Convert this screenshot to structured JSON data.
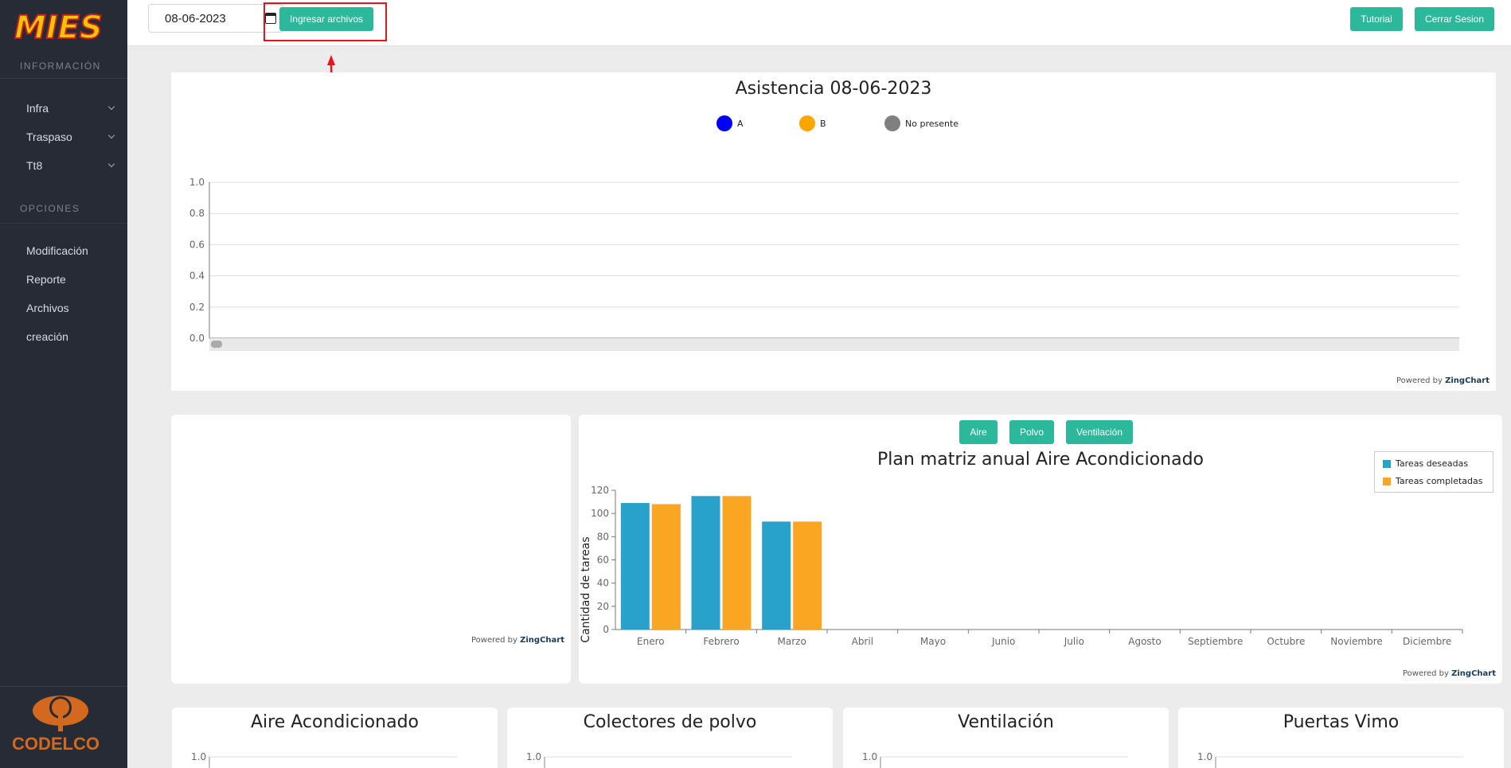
{
  "sidebar": {
    "logo_text": "MIES",
    "section_info": "INFORMACIÓN",
    "info_items": [
      {
        "label": "Infra"
      },
      {
        "label": "Traspaso"
      },
      {
        "label": "Tt8"
      }
    ],
    "section_options": "OPCIONES",
    "option_items": [
      {
        "label": "Modificación"
      },
      {
        "label": "Reporte"
      },
      {
        "label": "Archivos"
      },
      {
        "label": "creación"
      }
    ],
    "footer_logo_text": "CODELCO"
  },
  "topbar": {
    "date_value": "08-06-2023",
    "upload_button": "Ingresar archivos",
    "tutorial_button": "Tutorial",
    "logout_button": "Cerrar Sesion"
  },
  "colors": {
    "accent": "#2cb89a",
    "annotation": "#e4151c",
    "series_blue": "#29a2cb",
    "series_orange": "#fba623"
  },
  "attendance_chart": {
    "title": "Asistencia 08-06-2023",
    "legend": [
      {
        "label": "A",
        "color": "#0000ff"
      },
      {
        "label": "B",
        "color": "#ffa500"
      },
      {
        "label": "No presente",
        "color": "#808080"
      }
    ],
    "y_ticks": [
      "1.0",
      "0.8",
      "0.6",
      "0.4",
      "0.2",
      "0.0"
    ],
    "powered_prefix": "Powered by",
    "powered_brand": "ZingChart"
  },
  "empty_chart": {
    "powered_prefix": "Powered by",
    "powered_brand": "ZingChart"
  },
  "plan_chart": {
    "filter_buttons": [
      {
        "label": "Aire"
      },
      {
        "label": "Polvo"
      },
      {
        "label": "Ventilación"
      }
    ],
    "powered_prefix": "Powered by",
    "powered_brand": "ZingChart"
  },
  "chart_data": [
    {
      "type": "bar",
      "title": "Asistencia 08-06-2023",
      "series": [
        {
          "name": "A",
          "values": []
        },
        {
          "name": "B",
          "values": []
        },
        {
          "name": "No presente",
          "values": []
        }
      ],
      "ylim": [
        0,
        1.0
      ],
      "grid": true,
      "legend_position": "top-center"
    },
    {
      "type": "bar",
      "title": "Plan matriz anual Aire Acondicionado",
      "ylabel": "Cantidad de tareas",
      "categories": [
        "Enero",
        "Febrero",
        "Marzo",
        "Abril",
        "Mayo",
        "Junio",
        "Julio",
        "Agosto",
        "Septiembre",
        "Octubre",
        "Noviembre",
        "Diciembre"
      ],
      "series": [
        {
          "name": "Tareas deseadas",
          "color": "#29a2cb",
          "values": [
            109,
            115,
            93,
            null,
            null,
            null,
            null,
            null,
            null,
            null,
            null,
            null
          ]
        },
        {
          "name": "Tareas completadas",
          "color": "#fba623",
          "values": [
            108,
            115,
            93,
            null,
            null,
            null,
            null,
            null,
            null,
            null,
            null,
            null
          ]
        }
      ],
      "y_ticks": [
        0,
        20,
        40,
        60,
        80,
        100,
        120
      ],
      "ylim": [
        0,
        120
      ],
      "legend_position": "top-right"
    },
    {
      "type": "line",
      "title": "Aire Acondicionado",
      "y_ticks_visible": [
        "1.0"
      ]
    },
    {
      "type": "line",
      "title": "Colectores de polvo",
      "y_ticks_visible": [
        "1.0"
      ]
    },
    {
      "type": "line",
      "title": "Ventilación",
      "y_ticks_visible": [
        "1.0"
      ]
    },
    {
      "type": "line",
      "title": "Puertas Vimo",
      "y_ticks_visible": [
        "1.0"
      ]
    }
  ]
}
